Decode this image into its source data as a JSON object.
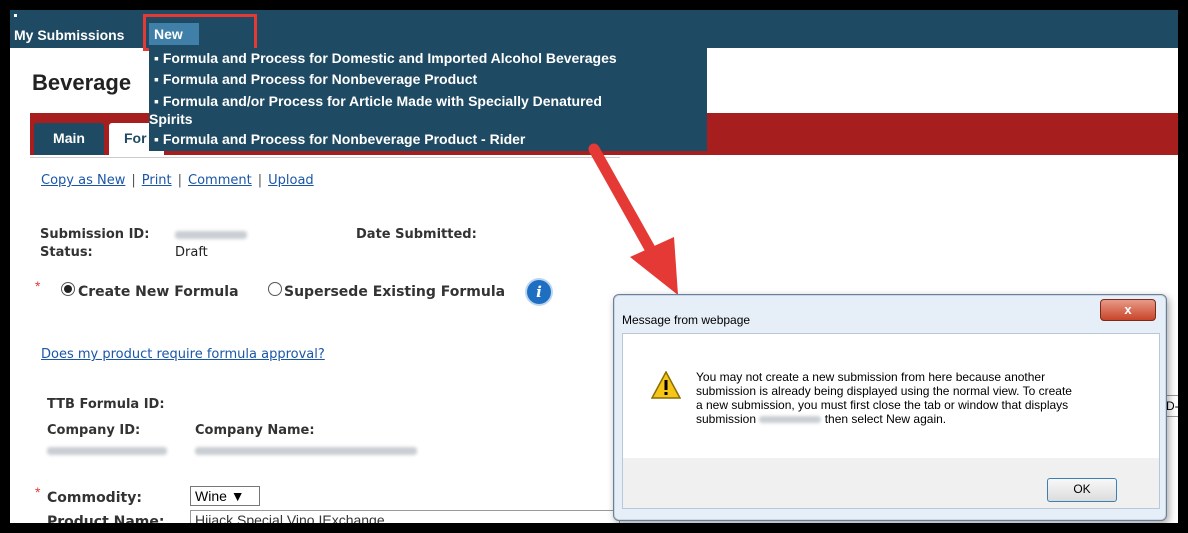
{
  "nav": {
    "my_submissions": "My Submissions",
    "new": "New"
  },
  "menu": {
    "items": [
      "▪ Formula and Process for Domestic and Imported Alcohol Beverages",
      "▪ Formula and Process for Nonbeverage Product",
      "▪ Formula and/or Process for Article Made with Specially Denatured",
      "Spirits",
      "▪ Formula and Process for Nonbeverage Product - Rider"
    ]
  },
  "page": {
    "title": "Beverage"
  },
  "tabs": {
    "main": "Main",
    "form": "For"
  },
  "actions": {
    "copy_as_new": "Copy as New",
    "print": "Print",
    "comment": "Comment",
    "upload": "Upload",
    "separator": "|"
  },
  "submission": {
    "id_label": "Submission ID:",
    "date_label": "Date Submitted:",
    "status_label": "Status:",
    "status_value": "Draft"
  },
  "formula_choice": {
    "required_mark": "*",
    "create_new": "Create New Formula",
    "supersede": "Supersede Existing Formula",
    "info_glyph": "i"
  },
  "links": {
    "require_approval": "Does my product require formula approval?"
  },
  "fields": {
    "ttb_formula_id_label": "TTB Formula ID:",
    "company_id_label": "Company ID:",
    "company_name_label": "Company Name:",
    "commodity_label": "Commodity:",
    "commodity_value": "Wine",
    "product_name_label": "Product Name:",
    "product_name_value": "Hijack Special Vino IExchange"
  },
  "dialog": {
    "title": "Message from webpage",
    "close_glyph": "x",
    "line1": "You may not create a new submission from here because another",
    "line2": "submission is already being displayed using the normal view. To create",
    "line3": "a new submission, you must first close the tab or window that displays",
    "line4_a": "submission",
    "line4_b": "then select New again.",
    "ok": "OK"
  },
  "fragments": {
    "right_field": "D-"
  },
  "colors": {
    "navy": "#1f4a63",
    "accent_red": "#a61e1e",
    "highlight": "#e53935",
    "link": "#1a56a8"
  }
}
